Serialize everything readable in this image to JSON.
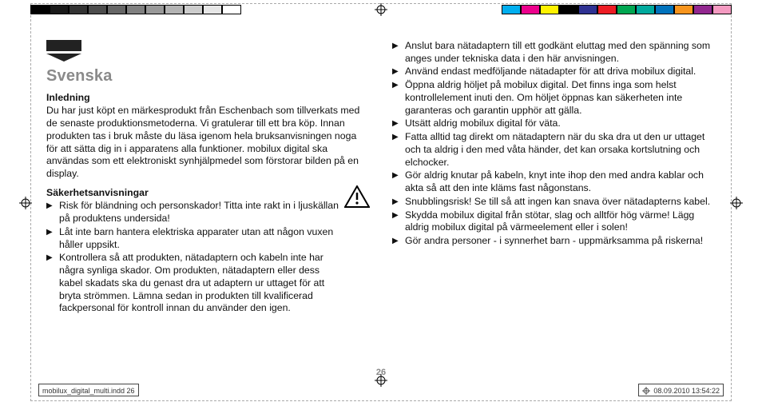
{
  "language": "Svenska",
  "section_intro_title": "Inledning",
  "intro_body": "Du har just köpt en märkesprodukt från Eschenbach som tillverkats med de senaste produktionsmetoderna. Vi gratulerar till ett bra köp. Innan produkten tas i bruk måste du läsa igenom hela bruksanvisningen noga för att sätta dig in i apparatens alla funktioner. mobilux digital ska användas som ett elektroniskt synhjälpmedel som förstorar bilden på en display.",
  "section_safety_title": "Säkerhetsanvisningar",
  "left_items": [
    "Risk för bländning och personskador! Titta inte rakt in i ljuskällan på produktens undersida!",
    "Låt inte barn hantera elektriska apparater utan att någon vuxen håller uppsikt.",
    "Kontrollera så att produkten, nätadaptern och kabeln inte har några synliga skador. Om produkten, nätadaptern eller dess kabel skadats ska du genast dra ut adaptern ur uttaget för att bryta strömmen. Lämna sedan in produkten till kvalificerad fackpersonal för kontroll innan du använder den igen."
  ],
  "right_items": [
    "Anslut bara nätadaptern till ett godkänt eluttag med den spänning som anges under tekniska data i den här anvisningen.",
    "Använd endast medföljande nätadapter för att driva mobilux digital.",
    "Öppna aldrig höljet på mobilux digital. Det finns inga som helst kontrollelement inuti den. Om höljet öppnas kan säkerheten inte garanteras och garantin upphör att gälla.",
    "Utsätt aldrig mobilux digital för väta.",
    "Fatta alltid tag direkt om nätadaptern när du ska dra ut den ur uttaget och ta aldrig i den med våta händer, det kan orsaka kortslutning och elchocker.",
    "Gör aldrig knutar på kabeln, knyt inte ihop den med andra kablar och akta så att den inte kläms fast någonstans.",
    "Snubblingsrisk! Se till så att ingen kan snava över nätadapterns kabel.",
    "Skydda mobilux digital från stötar, slag och alltför hög värme! Lägg aldrig mobilux digital på värmeelement eller i solen!",
    "Gör andra personer - i synnerhet barn - uppmärksamma på riskerna!"
  ],
  "page_number": "26",
  "footer_file": "mobilux_digital_multi.indd   26",
  "footer_date": "08.09.2010   13:54:22"
}
